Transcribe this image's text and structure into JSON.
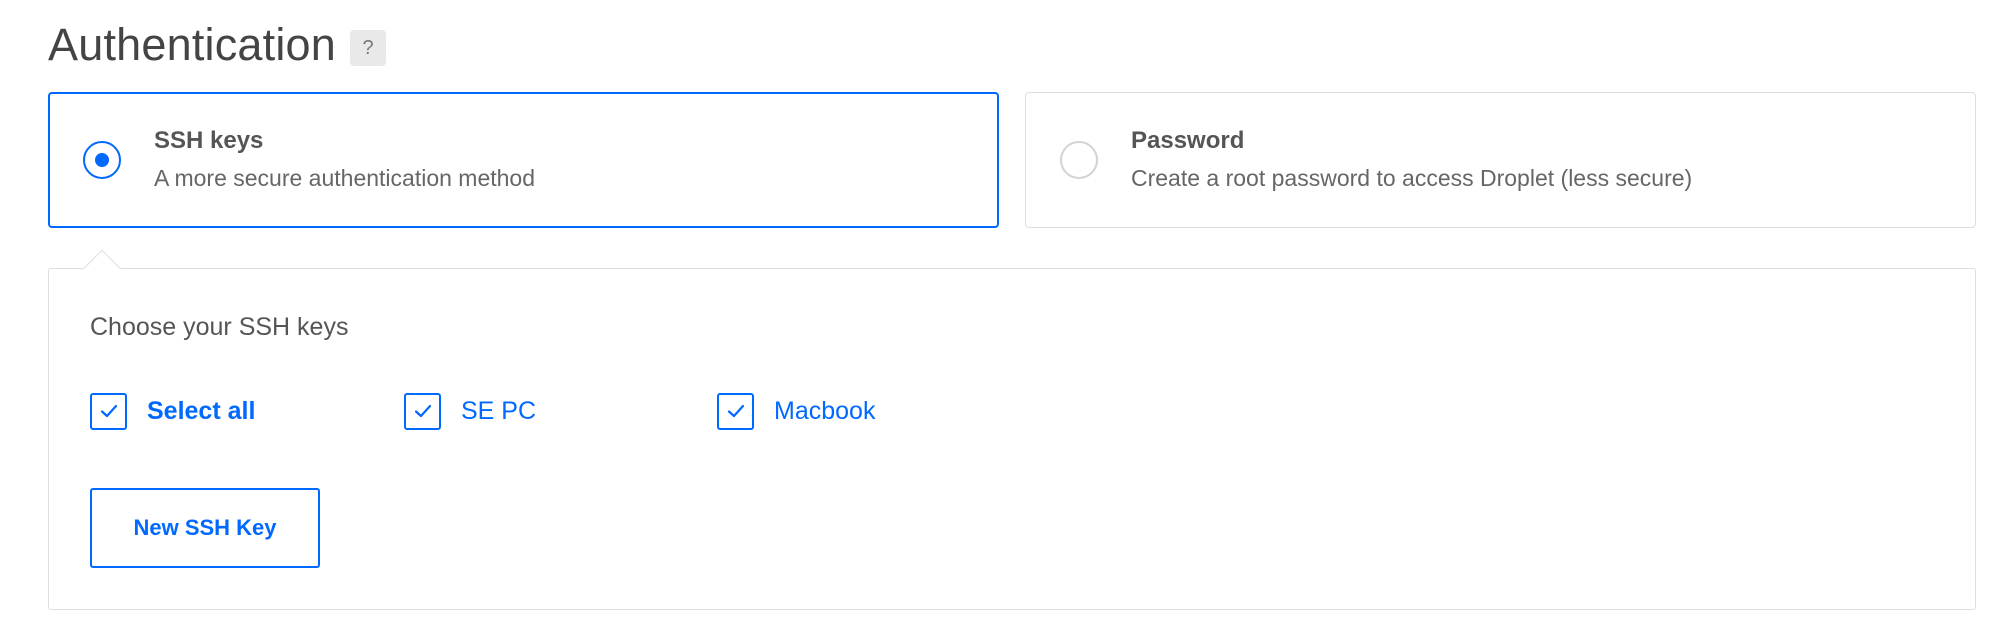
{
  "section": {
    "title": "Authentication",
    "help_label": "?"
  },
  "options": [
    {
      "title": "SSH keys",
      "description": "A more secure authentication method",
      "selected": true
    },
    {
      "title": "Password",
      "description": "Create a root password to access Droplet (less secure)",
      "selected": false
    }
  ],
  "ssh_panel": {
    "label": "Choose your SSH keys",
    "keys": [
      {
        "label": "Select all",
        "checked": true
      },
      {
        "label": "SE PC",
        "checked": true
      },
      {
        "label": "Macbook",
        "checked": true
      }
    ],
    "new_key_button": "New SSH Key"
  },
  "colors": {
    "accent": "#0069ff",
    "border": "#dfdfdf",
    "text": "#444444"
  },
  "icons": {
    "help": "question-mark",
    "radio_selected": "radio-filled",
    "radio_unselected": "radio-empty",
    "checkbox": "checkmark"
  }
}
